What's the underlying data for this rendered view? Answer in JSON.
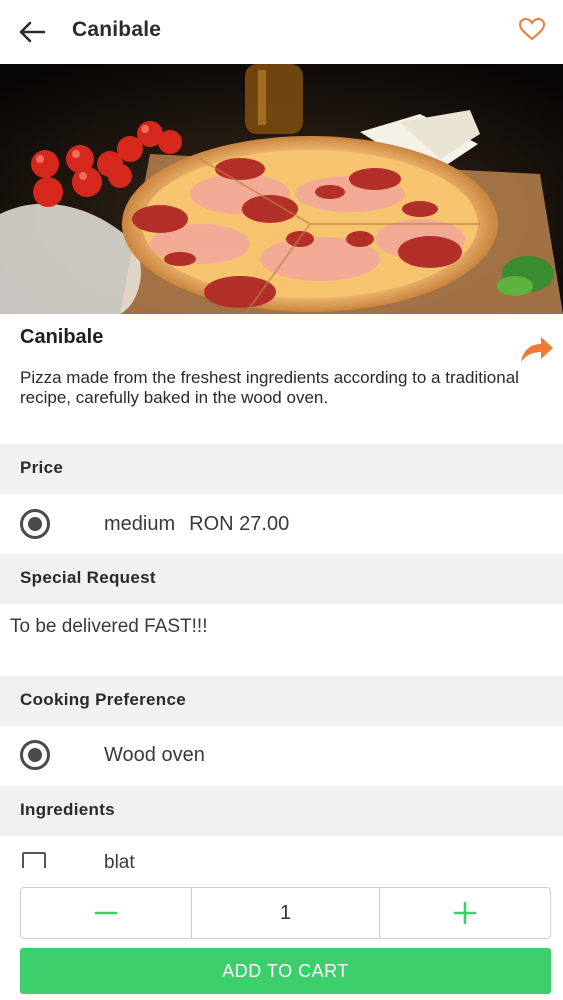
{
  "header": {
    "title": "Canibale"
  },
  "product": {
    "name": "Canibale",
    "description": "Pizza made from the freshest ingredients according to a traditional recipe, carefully baked in the wood oven."
  },
  "sections": {
    "price": {
      "title": "Price",
      "options": [
        {
          "size": "medium",
          "price": "RON 27.00",
          "selected": true
        }
      ]
    },
    "special_request": {
      "title": "Special Request",
      "text": "To be delivered FAST!!!"
    },
    "cooking": {
      "title": "Cooking Preference",
      "options": [
        {
          "label": "Wood oven",
          "selected": true
        }
      ]
    },
    "ingredients": {
      "title": "Ingredients",
      "items": [
        {
          "label": "blat",
          "checked": false
        }
      ]
    }
  },
  "cart": {
    "quantity": "1",
    "add_label": "ADD TO CART"
  },
  "colors": {
    "accent": "#f07a3a",
    "green": "#3ccf6b",
    "section_bg": "#f1f1f1"
  },
  "icons": {
    "back": "arrow-left-icon",
    "favorite": "heart-outline-icon",
    "share": "share-arrow-icon",
    "minus": "minus-icon",
    "plus": "plus-icon"
  }
}
